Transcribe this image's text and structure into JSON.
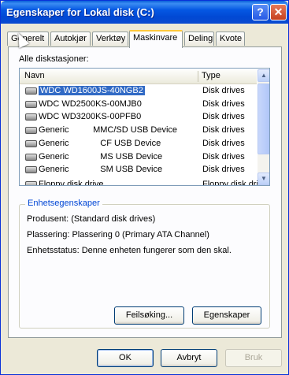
{
  "window": {
    "title": "Egenskaper for Lokal disk (C:)",
    "help_glyph": "?",
    "close_glyph": "✕"
  },
  "tabs": [
    {
      "label": "Generelt"
    },
    {
      "label": "Autokjør"
    },
    {
      "label": "Verktøy"
    },
    {
      "label": "Maskinvare"
    },
    {
      "label": "Deling"
    },
    {
      "label": "Kvote"
    }
  ],
  "drives_label": "Alle diskstasjoner:",
  "list": {
    "columns": {
      "name": "Navn",
      "type": "Type"
    },
    "rows": [
      {
        "name": "WDC WD1600JS-40NGB2",
        "type": "Disk drives",
        "selected": true
      },
      {
        "name": "WDC WD2500KS-00MJB0",
        "type": "Disk drives"
      },
      {
        "name": "WDC WD3200KS-00PFB0",
        "type": "Disk drives"
      },
      {
        "name": "Generic          MMC/SD USB Device",
        "type": "Disk drives"
      },
      {
        "name": "Generic             CF USB Device",
        "type": "Disk drives"
      },
      {
        "name": "Generic             MS USB Device",
        "type": "Disk drives"
      },
      {
        "name": "Generic             SM USB Device",
        "type": "Disk drives"
      },
      {
        "name": "Floppy disk drive",
        "type": "Floppy disk drive"
      }
    ]
  },
  "properties": {
    "group_title": "Enhetsegenskaper",
    "manufacturer": "Produsent: (Standard disk drives)",
    "location": "Plassering: Plassering 0 (Primary ATA Channel)",
    "status": "Enhetsstatus: Denne enheten fungerer som den skal.",
    "troubleshoot_button": "Feilsøking...",
    "properties_button": "Egenskaper"
  },
  "footer": {
    "ok": "OK",
    "cancel": "Avbryt",
    "apply": "Bruk"
  },
  "colors": {
    "accent": "#316ac5",
    "title_blue": "#0558e3",
    "group_title": "#0046d5"
  }
}
